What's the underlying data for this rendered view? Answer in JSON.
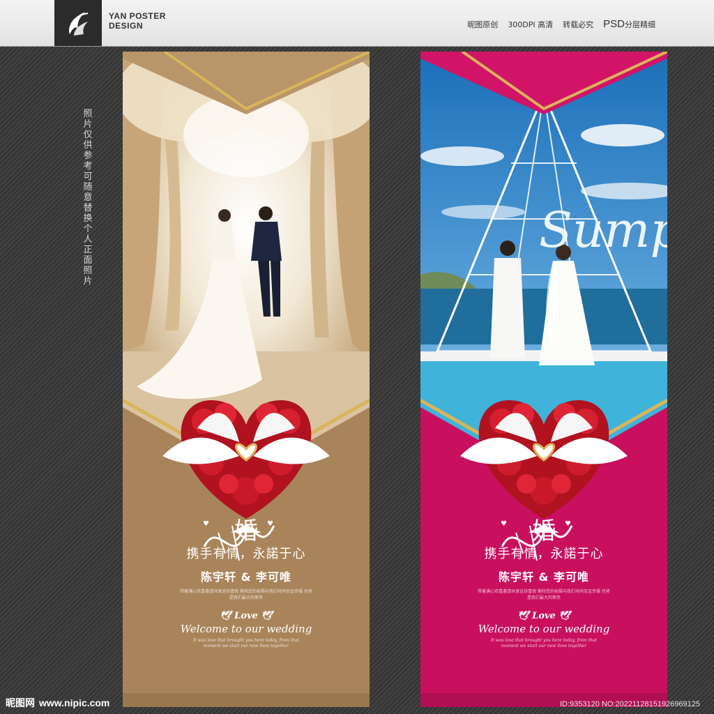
{
  "header": {
    "brand_line1": "YAN POSTER",
    "brand_line2": "DESIGN",
    "brand_sub": "",
    "items": [
      "昵图原创",
      "300DPI 高清",
      "转载必究"
    ],
    "psd": "PSD",
    "psd_suffix": "分层精细"
  },
  "side_note": "照片仅供参考 可随意替换个人正面照片",
  "posters": [
    {
      "theme": "kraft",
      "script_title": "婚",
      "vows": "携手有情，永諾于心",
      "names": "陈宇轩 & 李可唯",
      "invite": "带着满心欢喜邀请共享这份喜悦 期待您的祝福与我们共同见证幸福 也将是我们最大的荣幸",
      "love": "Love",
      "welcome": "Welcome to our wedding",
      "small_en": "It was love that brought you here today, from that moment we start our new lives together"
    },
    {
      "theme": "magenta",
      "script_title": "婚",
      "overlay_text": "Sump",
      "vows": "携手有情，永諾于心",
      "names": "陈宇轩 & 李可唯",
      "invite": "带着满心欢喜邀请共享这份喜悦 期待您的祝福与我们共同见证幸福 也将是我们最大的荣幸",
      "love": "Love",
      "welcome": "Welcome to our wedding",
      "small_en": "It was love that brought you here today, from that moment we start our new lives together"
    }
  ],
  "footer": {
    "site_name": "昵图网",
    "site_url": "www.nipic.com",
    "id_line": "ID:9353120 NO:20221128151926969125"
  },
  "colors": {
    "kraft": "#a9845a",
    "magenta": "#c8105f",
    "gold": "#d9b45a",
    "rose": "#c8162a"
  }
}
